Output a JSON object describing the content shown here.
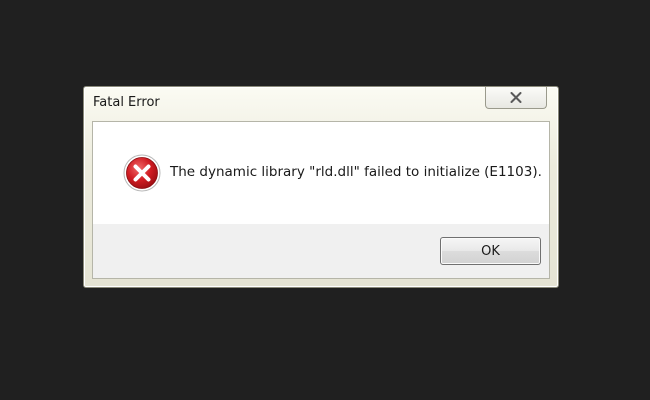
{
  "dialog": {
    "title": "Fatal Error",
    "message": "The dynamic library \"rld.dll\" failed to initialize (E1103).",
    "icon": "error-icon",
    "ok_label": "OK",
    "close_icon": "close-icon"
  },
  "colors": {
    "background": "#202020",
    "error_red": "#c8141c",
    "content_bg": "#ffffff",
    "footer_bg": "#f0f0f0"
  }
}
